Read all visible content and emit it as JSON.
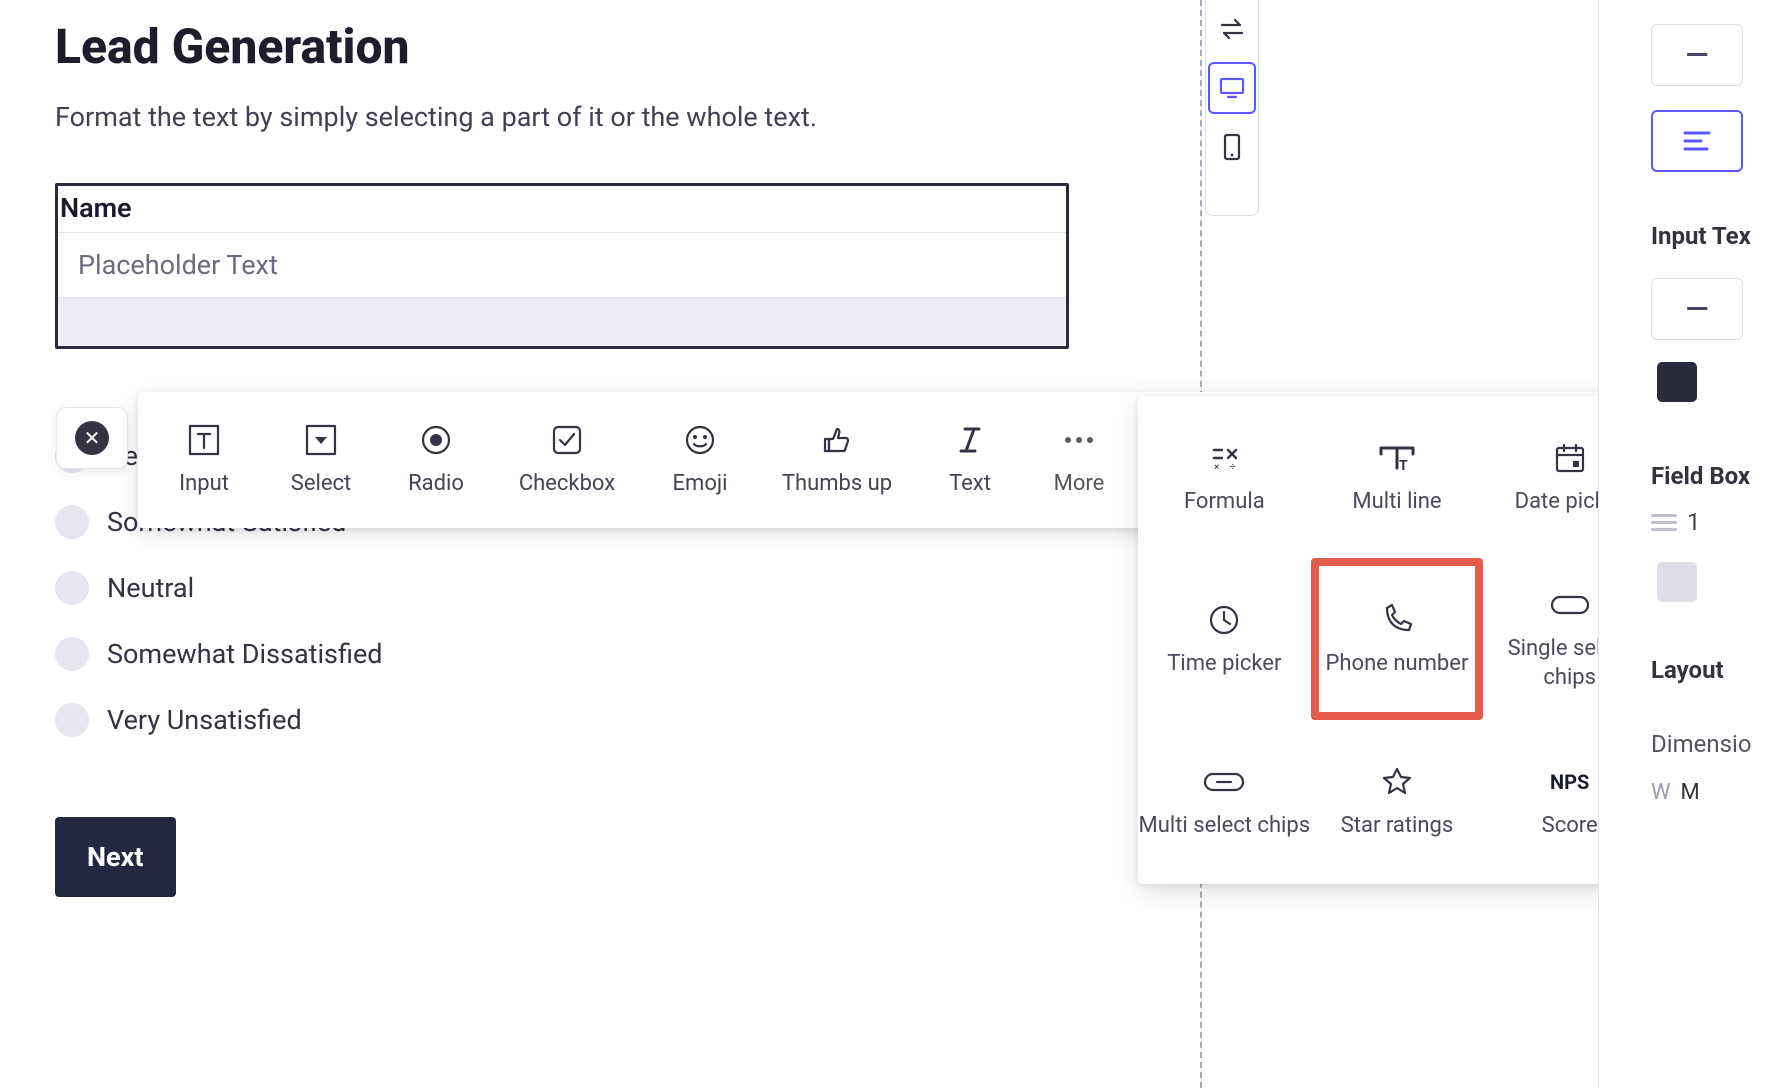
{
  "form": {
    "title": "Lead Generation",
    "subtitle": "Format the text by simply selecting a part of it or the whole text.",
    "field": {
      "label": "Name",
      "placeholder": "Placeholder Text"
    },
    "radios": {
      "opt0_prefix": "Ve",
      "opt1": "Somewhat Satisfied",
      "opt2": "Neutral",
      "opt3": "Somewhat Dissatisfied",
      "opt4": "Very Unsatisfied"
    },
    "next_label": "Next"
  },
  "toolbar": {
    "input": "Input",
    "select": "Select",
    "radio": "Radio",
    "checkbox": "Checkbox",
    "emoji": "Emoji",
    "thumbs": "Thumbs up",
    "text": "Text",
    "more": "More"
  },
  "ext": {
    "formula": "Formula",
    "multiline": "Multi line",
    "datepicker": "Date picker",
    "timepicker": "Time picker",
    "phone": "Phone number",
    "singlechips": "Single select chips",
    "multichips": "Multi select chips",
    "star": "Star ratings",
    "score": "Score",
    "nps": "NPS"
  },
  "right": {
    "minus": "—",
    "input_text": "Input Tex",
    "field_box": "Field Box",
    "one": "1",
    "layout": "Layout",
    "dimensions": "Dimensio",
    "w": "W",
    "m": "M"
  }
}
